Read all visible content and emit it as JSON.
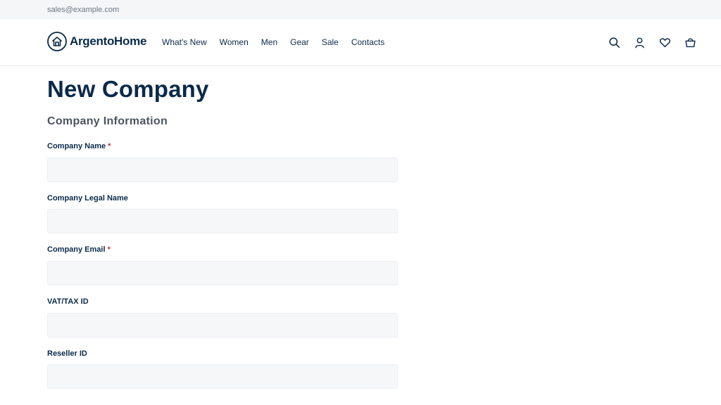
{
  "topbar": {
    "email": "sales@example.com"
  },
  "brand": {
    "name": "ArgentoHome",
    "icon": "house-logo-icon"
  },
  "nav": {
    "items": [
      {
        "label": "What's New"
      },
      {
        "label": "Women"
      },
      {
        "label": "Men"
      },
      {
        "label": "Gear"
      },
      {
        "label": "Sale"
      },
      {
        "label": "Contacts"
      }
    ]
  },
  "header_icons": [
    "search-icon",
    "account-icon",
    "wishlist-heart-icon",
    "cart-basket-icon"
  ],
  "page": {
    "title": "New Company",
    "section_title": "Company Information"
  },
  "form": {
    "fields": [
      {
        "label": "Company Name",
        "required": "*",
        "value": ""
      },
      {
        "label": "Company Legal Name",
        "value": ""
      },
      {
        "label": "Company Email",
        "required": "*",
        "value": ""
      },
      {
        "label": "VAT/TAX ID",
        "value": ""
      },
      {
        "label": "Reseller ID",
        "value": ""
      }
    ]
  },
  "colors": {
    "primary": "#0b2a4a",
    "required": "#d02f2f",
    "input_bg": "#f6f7f9",
    "topbar_bg": "#f5f6f8"
  }
}
